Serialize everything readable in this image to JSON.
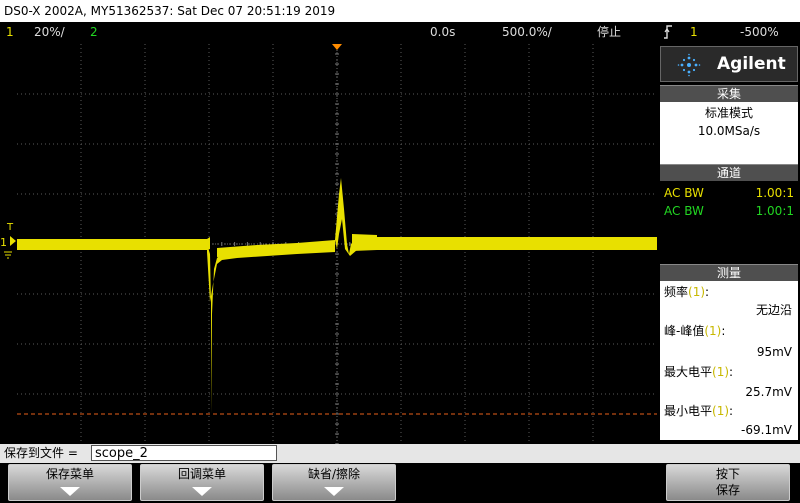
{
  "title": "DS0-X 2002A, MY51362537: Sat Dec 07 20:51:19 2019",
  "topbar": {
    "ch1_num": "1",
    "ch1_scale": "20%/",
    "ch2_num": "2",
    "time_pos": "0.0s",
    "time_scale": "500.0%/",
    "run_state": "停止",
    "trigger_icon": "trigger-edge-icon",
    "trig_source": "1",
    "trig_level": "-500%"
  },
  "logo": {
    "brand": "Agilent",
    "icon": "agilent-spark-icon"
  },
  "acquisition": {
    "title": "采集",
    "mode": "标准模式",
    "rate": "10.0MSa/s"
  },
  "channels": {
    "title": "通道",
    "items": [
      {
        "coupling": "AC BW",
        "ratio": "1.00:1",
        "color": "#e8e000"
      },
      {
        "coupling": "AC BW",
        "ratio": "1.00:1",
        "color": "#22d622"
      }
    ]
  },
  "measure": {
    "title": "测量",
    "items": [
      {
        "label": "频率",
        "src": "(1)",
        "colon": ":",
        "value": "无边沿"
      },
      {
        "label": "峰-峰值",
        "src": "(1)",
        "colon": ":",
        "value": "95mV"
      },
      {
        "label": "最大电平",
        "src": "(1)",
        "colon": ":",
        "value": "25.7mV"
      },
      {
        "label": "最小电平",
        "src": "(1)",
        "colon": ":",
        "value": "-69.1mV"
      }
    ]
  },
  "markers": {
    "trigger_level_marker": "T",
    "ch1_ground_marker": "1"
  },
  "save": {
    "label": "保存到文件 =",
    "filename": "scope_2"
  },
  "softkeys": [
    {
      "label": "保存菜单"
    },
    {
      "label": "回调菜单"
    },
    {
      "label": "缺省/擦除"
    },
    {
      "label_line1": "按下",
      "label_line2": "保存"
    }
  ],
  "colors": {
    "ch1": "#e8e000",
    "ch2": "#22d622",
    "trigger_line": "#e8601a",
    "grid": "#5a5a5a",
    "accent_orange": "#ff8c00"
  }
}
